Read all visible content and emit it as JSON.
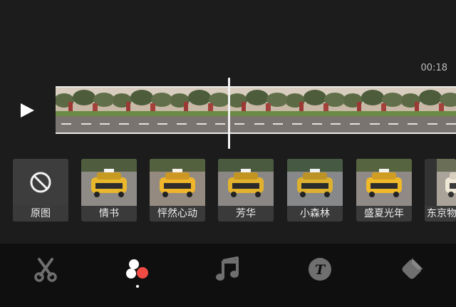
{
  "timeline": {
    "duration": "00:18"
  },
  "filters": [
    {
      "label": "原图",
      "icon": "no-filter-icon"
    },
    {
      "label": "情书"
    },
    {
      "label": "怦然心动"
    },
    {
      "label": "芳华"
    },
    {
      "label": "小森林"
    },
    {
      "label": "盛夏光年"
    },
    {
      "label": "东京物"
    }
  ],
  "toolbar": {
    "tabs": [
      {
        "icon": "scissors-icon"
      },
      {
        "icon": "filter-icon",
        "active": true
      },
      {
        "icon": "music-icon"
      },
      {
        "icon": "text-icon"
      },
      {
        "icon": "sticker-icon"
      }
    ]
  },
  "colors": {
    "background": "#1c1c1c",
    "toolbar_bg": "#0f0f0f",
    "accent_red": "#ef4b44"
  }
}
